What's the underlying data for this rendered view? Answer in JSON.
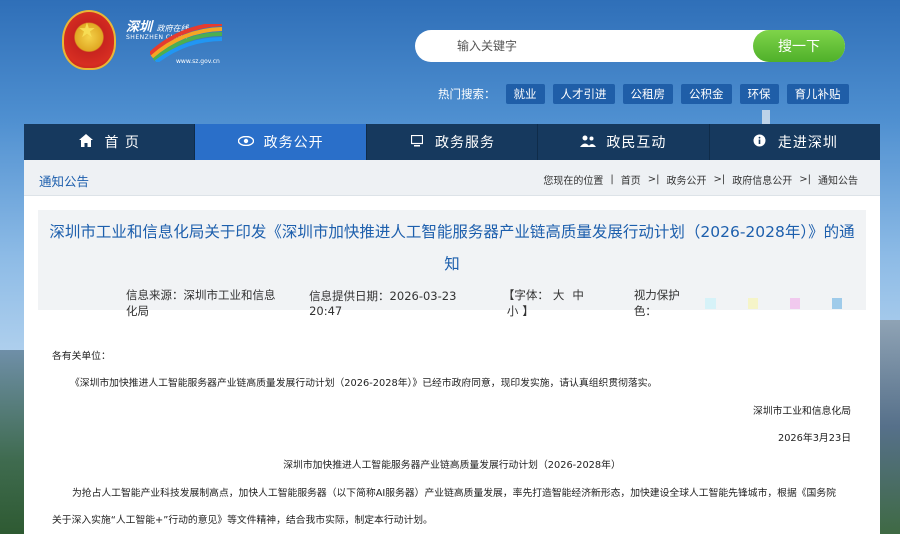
{
  "header": {
    "logo_title": "深圳",
    "logo_slogan": "政府在线",
    "logo_sub": "SHENZHEN CHINA",
    "logo_url": "www.sz.gov.cn",
    "search": {
      "placeholder": "输入关键字",
      "button_label": "搜一下"
    },
    "hot_label": "热门搜索：",
    "hot_tags": [
      "就业",
      "人才引进",
      "公租房",
      "公积金",
      "环保",
      "育儿补贴"
    ]
  },
  "nav": {
    "items": [
      {
        "label": "首 页",
        "icon": "home-icon"
      },
      {
        "label": "政务公开",
        "icon": "eye-icon"
      },
      {
        "label": "政务服务",
        "icon": "monitor-icon"
      },
      {
        "label": "政民互动",
        "icon": "people-icon"
      },
      {
        "label": "走进深圳",
        "icon": "info-icon"
      }
    ],
    "active_index": 1
  },
  "subbar": {
    "section_title": "通知公告",
    "breadcrumb": [
      "您现在的位置",
      "首页",
      "政务公开",
      "政府信息公开",
      "通知公告"
    ]
  },
  "article": {
    "title": "深圳市工业和信息化局关于印发《深圳市加快推进人工智能服务器产业链高质量发展行动计划（2026-2028年）》的通知",
    "source": "信息来源：深圳市工业和信息化局",
    "date": "信息提供日期：2026-03-23 20:47",
    "font_label": "【字体：",
    "font_sizes": [
      "大",
      "中",
      "小"
    ],
    "font_close": "】",
    "eye_label": "视力保护色：",
    "eye_colors": [
      "#d6f2f8",
      "#f5f4c8",
      "#f1c9ee",
      "#9fcbea"
    ],
    "salutation": "各有关单位：",
    "para1": "《深圳市加快推进人工智能服务器产业链高质量发展行动计划（2026-2028年）》已经市政府同意，现印发实施，请认真组织贯彻落实。",
    "signature": "深圳市工业和信息化局",
    "sign_date": "2026年3月23日",
    "doc_title": "深圳市加快推进人工智能服务器产业链高质量发展行动计划（2026-2028年）",
    "para2": "为抢占人工智能产业科技发展制高点，加快人工智能服务器（以下简称AI服务器）产业链高质量发展，率先打造智能经济新形态，加快建设全球人工智能先锋城市，根据《国务院",
    "para3": "关于深入实施“人工智能+”行动的意见》等文件精神，结合我市实际，制定本行动计划。"
  },
  "colors": {
    "nav_bg": "#16395e",
    "nav_active": "#2a6fc9",
    "title_blue": "#1d5fad",
    "search_green": "#4fb02a"
  }
}
